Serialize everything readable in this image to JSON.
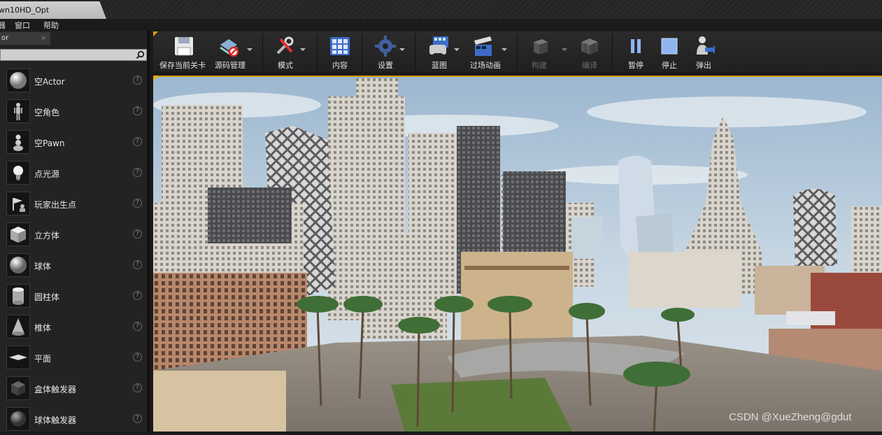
{
  "window": {
    "title_tab": "wn10HD_Opt"
  },
  "menu": {
    "items": [
      "窗口",
      "帮助"
    ],
    "partial_left": "器"
  },
  "left_panel": {
    "tab_label": "or",
    "tab_close": "×",
    "items": [
      {
        "label": "空Actor",
        "icon": "sphere-icon"
      },
      {
        "label": "空角色",
        "icon": "mannequin-icon"
      },
      {
        "label": "空Pawn",
        "icon": "pawn-icon"
      },
      {
        "label": "点光源",
        "icon": "lightbulb-icon"
      },
      {
        "label": "玩家出生点",
        "icon": "player-start-icon"
      },
      {
        "label": "立方体",
        "icon": "cube-icon"
      },
      {
        "label": "球体",
        "icon": "sphere-icon"
      },
      {
        "label": "圆柱体",
        "icon": "cylinder-icon"
      },
      {
        "label": "椎体",
        "icon": "cone-icon"
      },
      {
        "label": "平面",
        "icon": "plane-icon"
      },
      {
        "label": "盒体触发器",
        "icon": "box-trigger-icon"
      },
      {
        "label": "球体触发器",
        "icon": "sphere-trigger-icon"
      }
    ],
    "help_glyph": "?"
  },
  "toolbar": {
    "buttons": [
      {
        "label": "保存当前关卡",
        "icon": "save-icon"
      },
      {
        "label": "源码管理",
        "icon": "source-control-icon"
      },
      {
        "label": "模式",
        "icon": "modes-icon"
      },
      {
        "label": "内容",
        "icon": "content-icon"
      },
      {
        "label": "设置",
        "icon": "settings-icon"
      },
      {
        "label": "蓝图",
        "icon": "blueprint-icon"
      },
      {
        "label": "过场动画",
        "icon": "cinematics-icon"
      },
      {
        "label": "构建",
        "icon": "build-icon"
      },
      {
        "label": "编译",
        "icon": "compile-icon"
      },
      {
        "label": "暂停",
        "icon": "pause-icon"
      },
      {
        "label": "停止",
        "icon": "stop-icon"
      },
      {
        "label": "弹出",
        "icon": "eject-icon"
      }
    ]
  },
  "viewport": {
    "watermark": "CSDN @XueZheng@gdut"
  }
}
